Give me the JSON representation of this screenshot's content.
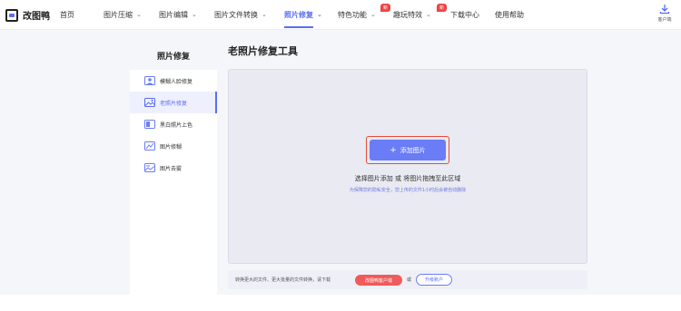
{
  "app": {
    "name": "改图鸭"
  },
  "nav": {
    "items": [
      {
        "label": "首页"
      },
      {
        "label": "图片压缩"
      },
      {
        "label": "图片编辑"
      },
      {
        "label": "图片文件转换"
      },
      {
        "label": "照片修复",
        "active": true
      },
      {
        "label": "特色功能",
        "badge": "新"
      },
      {
        "label": "趣玩特效",
        "badge": "新"
      },
      {
        "label": "下载中心"
      },
      {
        "label": "使用帮助"
      }
    ],
    "client_label": "客户端"
  },
  "sidebar": {
    "title": "照片修复",
    "items": [
      {
        "label": "模糊人脸修复"
      },
      {
        "label": "老照片修复",
        "active": true
      },
      {
        "label": "黑白照片上色"
      },
      {
        "label": "图片修糊"
      },
      {
        "label": "图片去雾"
      }
    ]
  },
  "main": {
    "title": "老照片修复工具",
    "add_button": "添加图片",
    "drop_hint": "选择图片添加 或 将图片拖拽至此区域",
    "drop_sub": "为保障您的隐私安全，您上传的文件1小时后会被自动删除"
  },
  "footer": {
    "text": "转换更大的文件、更大批量的文件转换，请下载",
    "client_button": "改图鸭客户端",
    "or": "或",
    "upgrade_button": "升级账户"
  },
  "colors": {
    "accent": "#5a6df0",
    "danger": "#e94a3a",
    "badge": "#ee4444"
  }
}
